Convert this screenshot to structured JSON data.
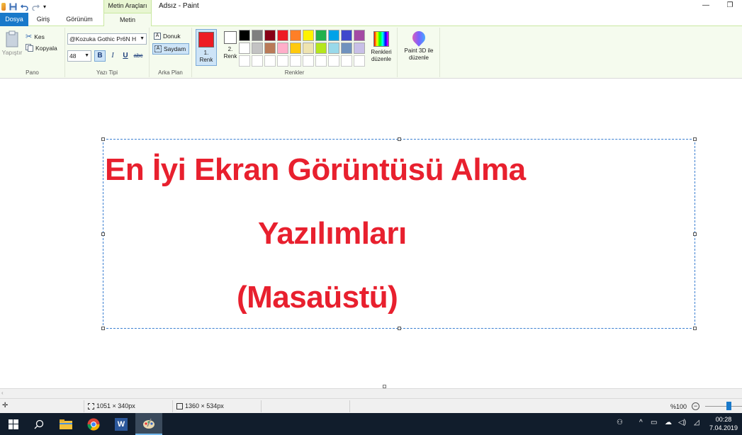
{
  "titlebar": {
    "app_title": "Adsız - Paint",
    "context_tab_header": "Metin Araçları"
  },
  "tabs": {
    "file": "Dosya",
    "home": "Giriş",
    "view": "Görünüm",
    "text": "Metin"
  },
  "clipboard": {
    "paste": "Yapıştır",
    "cut": "Kes",
    "copy": "Kopyala",
    "group": "Pano"
  },
  "font": {
    "family": "@Kozuka Gothic Pr6N H",
    "size": "48",
    "bold": "B",
    "italic": "I",
    "underline": "U",
    "strike": "abc",
    "group": "Yazı Tipi"
  },
  "background": {
    "opaque": "Donuk",
    "transparent": "Saydam",
    "group": "Arka Plan"
  },
  "colors": {
    "color1_line1": "1.",
    "color1_line2": "Renk",
    "color2_line1": "2.",
    "color2_line2": "Renk",
    "color1_value": "#ed1c24",
    "color2_value": "#ffffff",
    "edit_line1": "Renkleri",
    "edit_line2": "düzenle",
    "group": "Renkler",
    "palette": [
      "#000000",
      "#7f7f7f",
      "#880015",
      "#ed1c24",
      "#ff7f27",
      "#fff200",
      "#22b14c",
      "#00a2e8",
      "#3f48cc",
      "#a349a4",
      "#ffffff",
      "#c3c3c3",
      "#b97a57",
      "#ffaec9",
      "#ffc90e",
      "#efe4b0",
      "#b5e61d",
      "#99d9ea",
      "#7092be",
      "#c8bfe7",
      "#ffffff",
      "#ffffff",
      "#ffffff",
      "#ffffff",
      "#ffffff",
      "#ffffff",
      "#ffffff",
      "#ffffff",
      "#ffffff",
      "#ffffff"
    ]
  },
  "paint3d": {
    "line1": "Paint 3D ile",
    "line2": "düzenle"
  },
  "canvas": {
    "line1": "En İyi Ekran Görüntüsü Alma",
    "line2": "Yazılımları",
    "line3": "(Masaüstü)",
    "text_color": "#e8202e"
  },
  "statusbar": {
    "selection_size": "1051 × 340px",
    "image_size": "1360 × 534px",
    "zoom": "%100"
  },
  "taskbar": {
    "time": "00:28",
    "date": "7.04.2019"
  }
}
